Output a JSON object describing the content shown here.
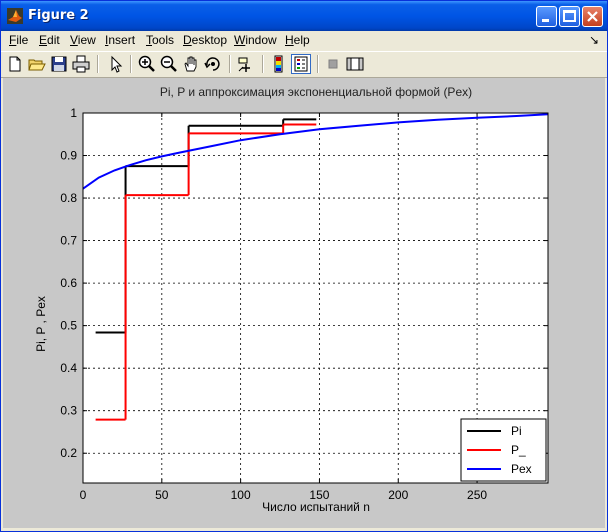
{
  "window": {
    "title": "Figure 2"
  },
  "menu": {
    "items": [
      {
        "label": "File",
        "u": "F",
        "rest": "ile"
      },
      {
        "label": "Edit",
        "u": "E",
        "rest": "dit"
      },
      {
        "label": "View",
        "u": "V",
        "rest": "iew"
      },
      {
        "label": "Insert",
        "u": "I",
        "rest": "nsert"
      },
      {
        "label": "Tools",
        "u": "T",
        "rest": "ools"
      },
      {
        "label": "Desktop",
        "u": "D",
        "rest": "esktop"
      },
      {
        "label": "Window",
        "u": "W",
        "rest": "indow"
      },
      {
        "label": "Help",
        "u": "H",
        "rest": "elp"
      }
    ],
    "dock_glyph": "↘"
  },
  "toolbar": {
    "icons": [
      "new-figure-icon",
      "open-file-icon",
      "save-icon",
      "print-icon",
      "pointer-icon",
      "zoom-in-icon",
      "zoom-out-icon",
      "pan-hand-icon",
      "rotate-3d-icon",
      "data-cursor-icon",
      "colorbar-icon",
      "legend-icon",
      "hide-plot-tools-icon",
      "show-plot-tools-icon"
    ],
    "pressed": "legend-icon"
  },
  "chart_data": {
    "type": "line",
    "title": "Pi, P  и аппроксимация экспоненциальной формой (Pex)",
    "xlabel": "Число испытаний n",
    "ylabel": "Pi, P , Pex",
    "xlim": [
      0,
      295
    ],
    "ylim": [
      0.13,
      1
    ],
    "xticks": [
      0,
      50,
      100,
      150,
      200,
      250
    ],
    "yticks": [
      0.2,
      0.3,
      0.4,
      0.5,
      0.6,
      0.7,
      0.8,
      0.9,
      1
    ],
    "grid": true,
    "legend_position": "bottom-right",
    "series": [
      {
        "name": "Pi",
        "color": "#000000",
        "segments": [
          {
            "x": [
              8,
              27
            ],
            "y": 0.484
          },
          {
            "x": 27,
            "y": [
              0.484,
              0.875
            ]
          },
          {
            "x": [
              27,
              67
            ],
            "y": 0.875
          },
          {
            "x": 67,
            "y": [
              0.875,
              0.97
            ]
          },
          {
            "x": [
              67,
              127
            ],
            "y": 0.97
          },
          {
            "x": 127,
            "y": [
              0.97,
              0.985
            ]
          },
          {
            "x": [
              127,
              148
            ],
            "y": 0.985
          }
        ]
      },
      {
        "name": "P_",
        "color": "#ff0000",
        "segments": [
          {
            "x": [
              8,
              27
            ],
            "y": 0.279
          },
          {
            "x": 27,
            "y": [
              0.279,
              0.807
            ]
          },
          {
            "x": [
              27,
              67
            ],
            "y": 0.807
          },
          {
            "x": 67,
            "y": [
              0.807,
              0.952
            ]
          },
          {
            "x": [
              67,
              127
            ],
            "y": 0.952
          },
          {
            "x": 127,
            "y": [
              0.952,
              0.973
            ]
          },
          {
            "x": [
              127,
              148
            ],
            "y": 0.973
          }
        ]
      },
      {
        "name": "Pex",
        "color": "#0000ff",
        "x": [
          0,
          10,
          20,
          30,
          40,
          50,
          60,
          80,
          100,
          125,
          150,
          175,
          200,
          225,
          250,
          275,
          295
        ],
        "y": [
          0.822,
          0.848,
          0.865,
          0.878,
          0.889,
          0.898,
          0.906,
          0.921,
          0.936,
          0.95,
          0.962,
          0.97,
          0.978,
          0.984,
          0.989,
          0.993,
          0.997
        ]
      }
    ]
  }
}
